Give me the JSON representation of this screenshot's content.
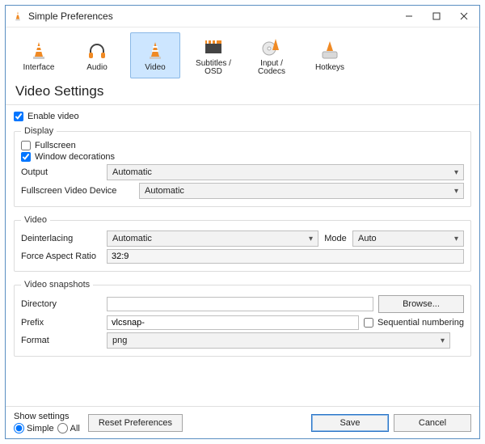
{
  "titlebar": {
    "title": "Simple Preferences"
  },
  "tabs": {
    "items": [
      {
        "label": "Interface"
      },
      {
        "label": "Audio"
      },
      {
        "label": "Video"
      },
      {
        "label": "Subtitles / OSD"
      },
      {
        "label": "Input / Codecs"
      },
      {
        "label": "Hotkeys"
      }
    ],
    "selected_index": 2
  },
  "section_title": "Video Settings",
  "enable_video": {
    "label": "Enable video",
    "checked": true
  },
  "display": {
    "legend": "Display",
    "fullscreen": {
      "label": "Fullscreen",
      "checked": false
    },
    "window_decorations": {
      "label": "Window decorations",
      "checked": true
    },
    "output": {
      "label": "Output",
      "value": "Automatic"
    },
    "fullscreen_device": {
      "label": "Fullscreen Video Device",
      "value": "Automatic"
    }
  },
  "video": {
    "legend": "Video",
    "deinterlacing": {
      "label": "Deinterlacing",
      "value": "Automatic"
    },
    "mode": {
      "label": "Mode",
      "value": "Auto"
    },
    "aspect": {
      "label": "Force Aspect Ratio",
      "value": "32:9"
    }
  },
  "snapshots": {
    "legend": "Video snapshots",
    "directory": {
      "label": "Directory",
      "value": "",
      "browse": "Browse..."
    },
    "prefix": {
      "label": "Prefix",
      "value": "vlcsnap-",
      "seq_label": "Sequential numbering",
      "seq_checked": false
    },
    "format": {
      "label": "Format",
      "value": "png"
    }
  },
  "footer": {
    "show_settings_label": "Show settings",
    "simple_label": "Simple",
    "all_label": "All",
    "mode": "simple",
    "reset": "Reset Preferences",
    "save": "Save",
    "cancel": "Cancel"
  }
}
